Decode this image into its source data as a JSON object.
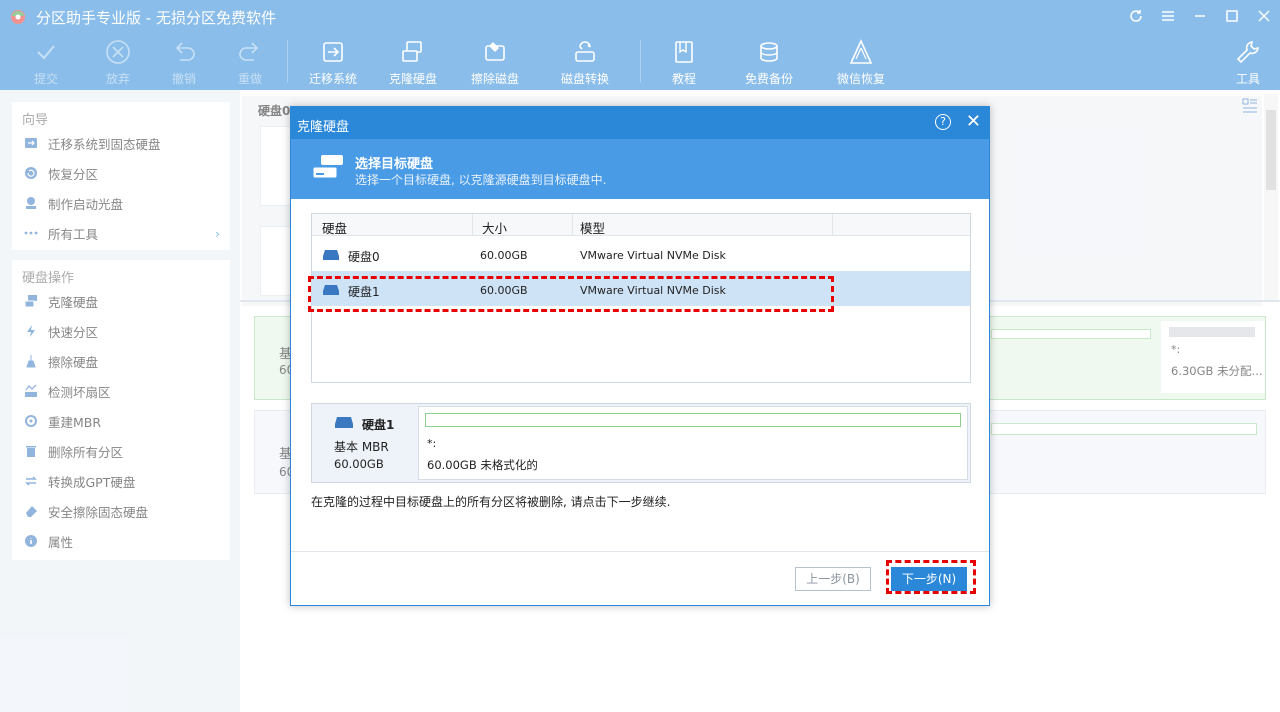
{
  "window": {
    "title": "分区助手专业版 - 无损分区免费软件"
  },
  "toolbar": {
    "commit": "提交",
    "discard": "放弃",
    "undo": "撤销",
    "redo": "重做",
    "migrate_os": "迁移系统",
    "clone_disk": "克隆硬盘",
    "wipe_disk": "擦除磁盘",
    "convert_disk": "磁盘转换",
    "tutorial": "教程",
    "free_backup": "免费备份",
    "wechat_recovery": "微信恢复",
    "tools": "工具"
  },
  "sidebar": {
    "wizard_title": "向导",
    "wizard_items": [
      {
        "label": "迁移系统到固态硬盘",
        "icon": "migrate-icon"
      },
      {
        "label": "恢复分区",
        "icon": "recover-icon"
      },
      {
        "label": "制作启动光盘",
        "icon": "bootdisc-icon"
      },
      {
        "label": "所有工具",
        "icon": "more-icon"
      }
    ],
    "disk_ops_title": "硬盘操作",
    "disk_ops_items": [
      {
        "label": "克隆硬盘",
        "icon": "clone-icon"
      },
      {
        "label": "快速分区",
        "icon": "lightning-icon"
      },
      {
        "label": "擦除硬盘",
        "icon": "broom-icon"
      },
      {
        "label": "检测坏扇区",
        "icon": "scan-icon"
      },
      {
        "label": "重建MBR",
        "icon": "rebuild-icon"
      },
      {
        "label": "删除所有分区",
        "icon": "trash-icon"
      },
      {
        "label": "转换成GPT硬盘",
        "icon": "convert-icon"
      },
      {
        "label": "安全擦除固态硬盘",
        "icon": "eraser-icon"
      },
      {
        "label": "属性",
        "icon": "info-icon"
      }
    ]
  },
  "main": {
    "disk_header": "硬盘0",
    "bg_row1_a": "基",
    "bg_row1_b": "60",
    "bg_row2_a": "基",
    "bg_row2_b": "60",
    "bg_unalloc_star": "*:",
    "bg_unalloc_text": "6.30GB 未分配..."
  },
  "dialog": {
    "title": "克隆硬盘",
    "help": "?",
    "header_title": "选择目标硬盘",
    "header_subtitle": "选择一个目标硬盘, 以克隆源硬盘到目标硬盘中.",
    "columns": [
      "硬盘",
      "大小",
      "模型"
    ],
    "rows": [
      {
        "disk": "硬盘0",
        "size": "60.00GB",
        "model": "VMware Virtual NVMe Disk",
        "selected": false
      },
      {
        "disk": "硬盘1",
        "size": "60.00GB",
        "model": "VMware Virtual NVMe Disk",
        "selected": true
      }
    ],
    "disk_detail": {
      "name": "硬盘1",
      "type": "基本 MBR",
      "size": "60.00GB",
      "partition_label": "*:",
      "partition_desc": "60.00GB 未格式化的"
    },
    "note": "在克隆的过程中目标硬盘上的所有分区将被删除, 请点击下一步继续.",
    "prev_button": "上一步(B)",
    "next_button": "下一步(N)"
  }
}
